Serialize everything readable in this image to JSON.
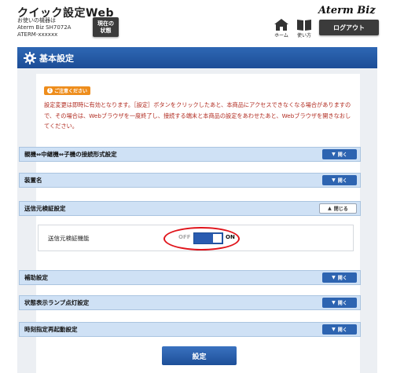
{
  "header": {
    "title": "クイック設定Web",
    "device_lines": [
      "お使いの機器は",
      "Aterm Biz SH7072A",
      "ATERM-xxxxxx"
    ],
    "status_button": [
      "現在の",
      "状態"
    ],
    "brand": "Aterm Biz",
    "home_label": "ホーム",
    "help_label": "使い方",
    "logout_label": "ログアウト"
  },
  "panel": {
    "title": "基本設定",
    "icon": "gear-icon"
  },
  "notice": {
    "badge": "ご注意ください",
    "text": "設定変更は即時に有効となります。［設定］ボタンをクリックしたあと、本商品にアクセスできなくなる場合がありますので、その場合は、Webブラウザを一度終了し、接続する端末と本商品の設定をあわせたあと、Webブラウザを開きなおしてください。"
  },
  "sections": [
    {
      "label": "親機⇔中継機⇔子機の接続形式設定",
      "button": "開く"
    },
    {
      "label": "装置名",
      "button": "開く"
    },
    {
      "label": "送信元検証設定",
      "button": "閉じる"
    },
    {
      "label": "補助設定",
      "button": "開く"
    },
    {
      "label": "状態表示ランプ点灯設定",
      "button": "開く"
    },
    {
      "label": "時刻指定再起動設定",
      "button": "開く"
    }
  ],
  "source_verification": {
    "label": "送信元検証機能",
    "off_label": "OFF",
    "on_label": "ON",
    "state": "ON"
  },
  "save_button": "設定",
  "colors": {
    "accent": "#1c4d96",
    "notice": "#ee8d1c",
    "warning_text": "#b02a1f",
    "highlight": "#e0141b"
  }
}
